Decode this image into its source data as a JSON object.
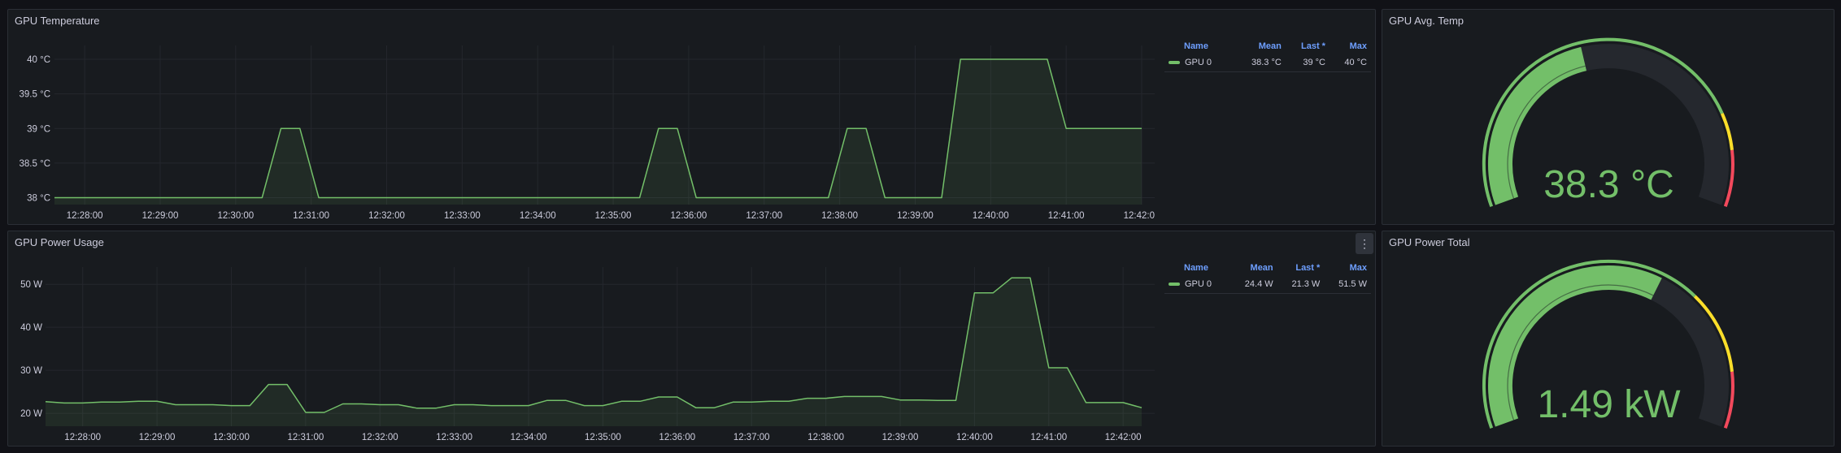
{
  "colors": {
    "series": "#73bf69",
    "accent": "#6e9fff",
    "yellow": "#fade2a",
    "red": "#f2495c",
    "track": "#25282e"
  },
  "temp_panel": {
    "title": "GPU Temperature",
    "legend": {
      "headers": [
        "Name",
        "Mean",
        "Last *",
        "Max"
      ],
      "rows": [
        [
          "GPU 0",
          "38.3 °C",
          "39 °C",
          "40 °C"
        ]
      ]
    }
  },
  "power_panel": {
    "title": "GPU Power Usage",
    "menu_icon": "more-vertical-icon",
    "menu_glyph": "⋮",
    "legend": {
      "headers": [
        "Name",
        "Mean",
        "Last *",
        "Max"
      ],
      "rows": [
        [
          "GPU 0",
          "24.4 W",
          "21.3 W",
          "51.5 W"
        ]
      ]
    }
  },
  "avg_temp_gauge": {
    "title": "GPU Avg. Temp",
    "value_text": "38.3 °C",
    "fraction": 0.44
  },
  "power_total_gauge": {
    "title": "GPU Power Total",
    "value_text": "1.49 kW",
    "fraction": 0.62
  },
  "chart_data": [
    {
      "type": "area",
      "yunit": "°C",
      "y_ticks": [
        "38 °C",
        "38.5 °C",
        "39 °C",
        "39.5 °C",
        "40 °C"
      ],
      "y_tick_values": [
        38,
        38.5,
        39,
        39.5,
        40
      ],
      "ylim": [
        37.9,
        40.2
      ],
      "x_ticks": [
        "12:28:00",
        "12:29:00",
        "12:30:00",
        "12:31:00",
        "12:32:00",
        "12:33:00",
        "12:34:00",
        "12:35:00",
        "12:36:00",
        "12:37:00",
        "12:38:00",
        "12:39:00",
        "12:40:00",
        "12:41:00",
        "12:42:00"
      ],
      "x_tick_minutes": [
        28,
        29,
        30,
        31,
        32,
        33,
        34,
        35,
        36,
        37,
        38,
        39,
        40,
        41,
        42
      ],
      "xlim": [
        27.6,
        42.0
      ],
      "grid": true,
      "legend_position": "right",
      "series": [
        {
          "name": "GPU 0",
          "x": [
            27.6,
            30.35,
            30.6,
            30.85,
            31.1,
            35.35,
            35.6,
            35.85,
            36.1,
            37.85,
            38.1,
            38.35,
            38.6,
            39.35,
            39.6,
            39.85,
            40.35,
            40.75,
            41.0,
            42.0
          ],
          "y": [
            38,
            38,
            39,
            39,
            38,
            38,
            39,
            39,
            38,
            38,
            39,
            39,
            38,
            38,
            40,
            40,
            40,
            40,
            39,
            39
          ]
        }
      ]
    },
    {
      "type": "area",
      "yunit": "W",
      "y_ticks": [
        "20 W",
        "30 W",
        "40 W",
        "50 W"
      ],
      "y_tick_values": [
        20,
        30,
        40,
        50
      ],
      "ylim": [
        17,
        54
      ],
      "x_ticks": [
        "12:28:00",
        "12:29:00",
        "12:30:00",
        "12:31:00",
        "12:32:00",
        "12:33:00",
        "12:34:00",
        "12:35:00",
        "12:36:00",
        "12:37:00",
        "12:38:00",
        "12:39:00",
        "12:40:00",
        "12:41:00",
        "12:42:00"
      ],
      "x_tick_minutes": [
        28,
        29,
        30,
        31,
        32,
        33,
        34,
        35,
        36,
        37,
        38,
        39,
        40,
        41,
        42
      ],
      "xlim": [
        27.5,
        42.25
      ],
      "grid": true,
      "legend_position": "right",
      "series": [
        {
          "name": "GPU 0",
          "x": [
            27.5,
            27.75,
            28.0,
            28.25,
            28.5,
            28.75,
            29.0,
            29.25,
            29.5,
            29.75,
            30.0,
            30.25,
            30.5,
            30.75,
            31.0,
            31.25,
            31.5,
            31.75,
            32.0,
            32.25,
            32.5,
            32.75,
            33.0,
            33.25,
            33.5,
            33.75,
            34.0,
            34.25,
            34.5,
            34.75,
            35.0,
            35.25,
            35.5,
            35.75,
            36.0,
            36.25,
            36.5,
            36.75,
            37.0,
            37.25,
            37.5,
            37.75,
            38.0,
            38.25,
            38.5,
            38.75,
            39.0,
            39.25,
            39.5,
            39.75,
            40.0,
            40.25,
            40.5,
            40.75,
            41.0,
            41.25,
            41.5,
            41.75,
            42.0,
            42.25
          ],
          "y": [
            22.7,
            22.4,
            22.4,
            22.6,
            22.6,
            22.8,
            22.8,
            22.0,
            22.0,
            22.0,
            21.8,
            21.8,
            26.7,
            26.7,
            20.2,
            20.2,
            22.2,
            22.2,
            22.0,
            22.0,
            21.2,
            21.2,
            22.0,
            22.0,
            21.8,
            21.8,
            21.8,
            23.0,
            23.0,
            21.8,
            21.8,
            22.8,
            22.8,
            23.8,
            23.8,
            21.3,
            21.3,
            22.6,
            22.6,
            22.8,
            22.8,
            23.5,
            23.5,
            23.9,
            23.9,
            23.9,
            23.1,
            23.1,
            23.0,
            23.0,
            48.0,
            48.0,
            51.5,
            51.5,
            30.6,
            30.6,
            22.5,
            22.5,
            22.5,
            21.3
          ]
        }
      ]
    }
  ]
}
